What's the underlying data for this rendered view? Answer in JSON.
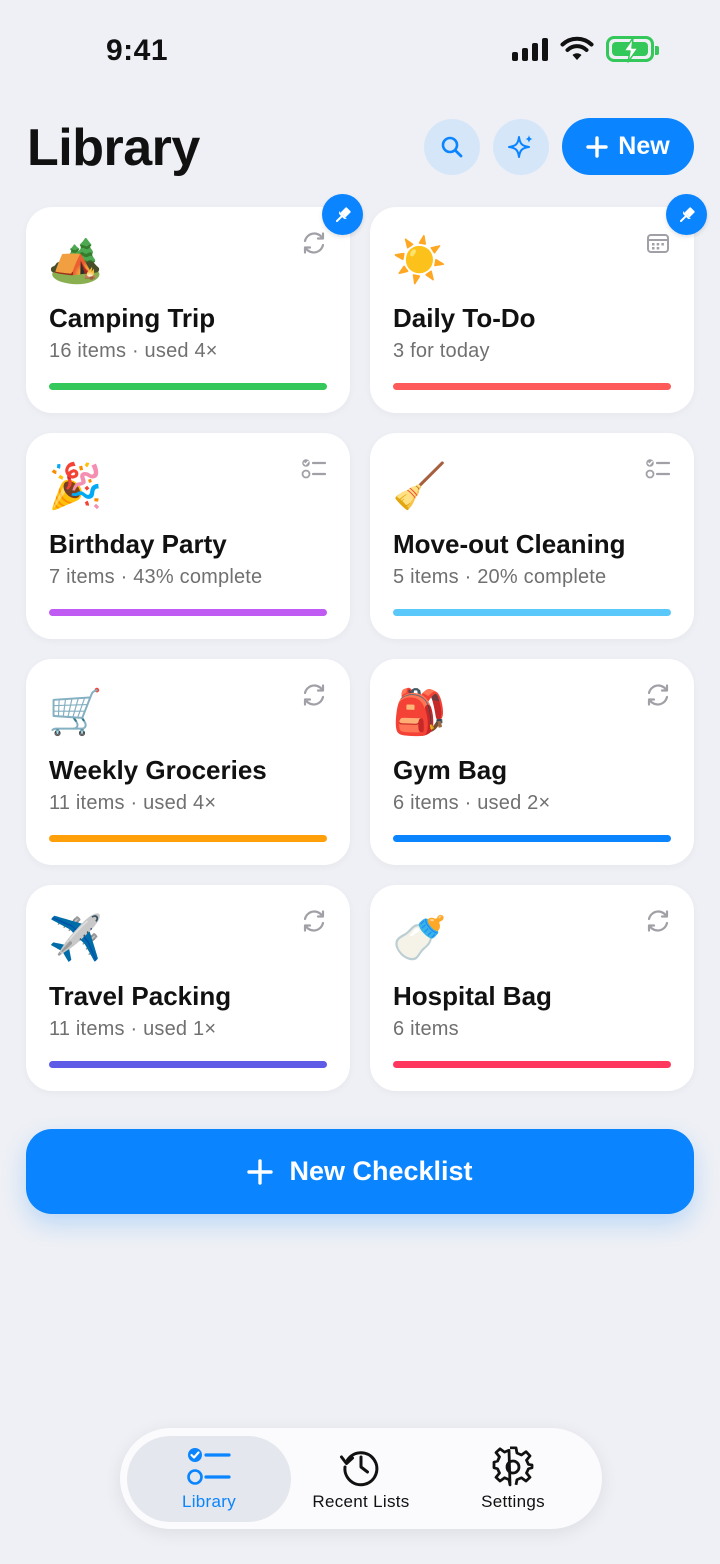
{
  "status_bar": {
    "time": "9:41"
  },
  "header": {
    "title": "Library",
    "search_icon": "search-icon",
    "magic_icon": "sparkles-icon",
    "new_label": "New"
  },
  "cards": [
    {
      "emoji": "🏕️",
      "title": "Camping Trip",
      "subtitle": "16 items · used 4×",
      "color": "#34c759",
      "icon": "repeat-icon",
      "pinned": true
    },
    {
      "emoji": "☀️",
      "title": "Daily To-Do",
      "subtitle": "3 for today",
      "color": "#ff5a5a",
      "icon": "calendar-icon",
      "pinned": true
    },
    {
      "emoji": "🎉",
      "title": "Birthday Party",
      "subtitle": "7 items · 43% complete",
      "color": "#bf5af2",
      "icon": "checklist-icon",
      "pinned": false
    },
    {
      "emoji": "🧹",
      "title": "Move-out Cleaning",
      "subtitle": "5 items · 20% complete",
      "color": "#5ac8fa",
      "icon": "checklist-icon",
      "pinned": false
    },
    {
      "emoji": "🛒",
      "title": "Weekly Groceries",
      "subtitle": "11 items · used 4×",
      "color": "#ff9f0a",
      "icon": "repeat-icon",
      "pinned": false
    },
    {
      "emoji": "🎒",
      "title": "Gym Bag",
      "subtitle": "6 items · used 2×",
      "color": "#0a84ff",
      "icon": "repeat-icon",
      "pinned": false
    },
    {
      "emoji": "✈️",
      "title": "Travel Packing",
      "subtitle": "11 items · used 1×",
      "color": "#5e5ce6",
      "icon": "repeat-icon",
      "pinned": false
    },
    {
      "emoji": "🍼",
      "title": "Hospital Bag",
      "subtitle": "6 items",
      "color": "#ff375f",
      "icon": "repeat-icon",
      "pinned": false
    }
  ],
  "cta": {
    "label": "New Checklist"
  },
  "tabs": [
    {
      "label": "Library",
      "icon": "library-icon",
      "active": true
    },
    {
      "label": "Recent Lists",
      "icon": "history-icon",
      "active": false
    },
    {
      "label": "Settings",
      "icon": "gear-icon",
      "active": false
    }
  ],
  "colors": {
    "accent": "#0a84ff",
    "background": "#eef0f5"
  }
}
